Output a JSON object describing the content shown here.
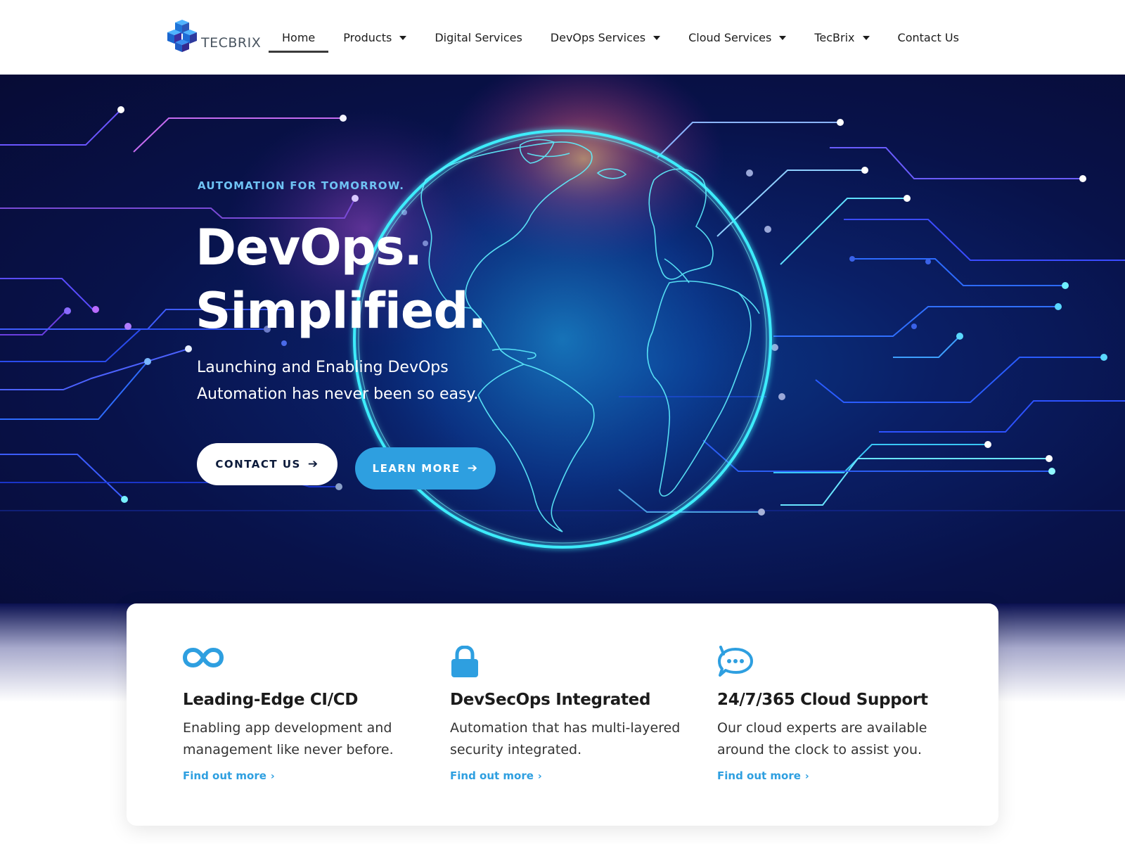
{
  "brand": {
    "name": "TECBRIX"
  },
  "nav": {
    "items": [
      {
        "label": "Home",
        "active": true,
        "dropdown": false
      },
      {
        "label": "Products",
        "active": false,
        "dropdown": true
      },
      {
        "label": "Digital Services",
        "active": false,
        "dropdown": false
      },
      {
        "label": "DevOps Services",
        "active": false,
        "dropdown": true
      },
      {
        "label": "Cloud Services",
        "active": false,
        "dropdown": true
      },
      {
        "label": "TecBrix",
        "active": false,
        "dropdown": true
      },
      {
        "label": "Contact Us",
        "active": false,
        "dropdown": false
      }
    ]
  },
  "hero": {
    "eyebrow": "AUTOMATION FOR TOMORROW.",
    "headline_line1": "DevOps.",
    "headline_line2": "Simplified.",
    "subtitle": "Launching and Enabling DevOps Automation has never been so easy.",
    "contact_button": "CONTACT US",
    "learn_button": "LEARN MORE"
  },
  "features": [
    {
      "icon": "infinity-icon",
      "title": "Leading-Edge CI/CD",
      "description": "Enabling app development and management like never before.",
      "link": "Find out more"
    },
    {
      "icon": "lock-icon",
      "title": "DevSecOps Integrated",
      "description": "Automation that has multi-layered security integrated.",
      "link": "Find out more"
    },
    {
      "icon": "chat-bubble-icon",
      "title": "24/7/365 Cloud Support",
      "description": "Our cloud experts are available around the clock to assist you.",
      "link": "Find out more"
    }
  ],
  "colors": {
    "accent": "#2e9fe0",
    "hero_bg": "#08124a",
    "eyebrow": "#6fc3f4",
    "glow_cyan": "#3ff2ff"
  }
}
